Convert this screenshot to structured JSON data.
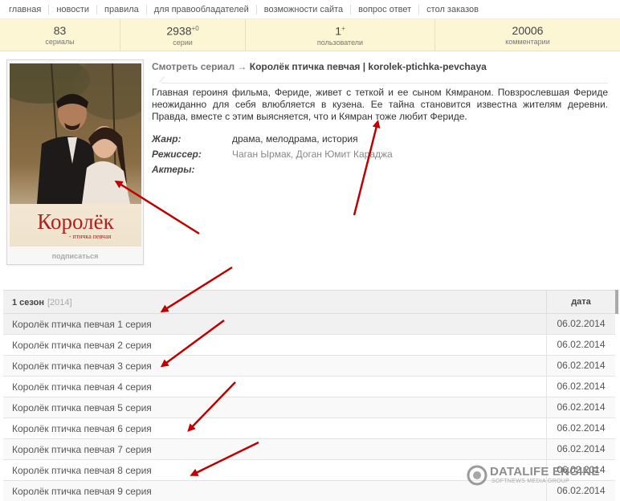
{
  "nav": {
    "items": [
      "главная",
      "новости",
      "правила",
      "для правообладателей",
      "возможности сайта",
      "вопрос ответ",
      "стол заказов"
    ]
  },
  "stats": [
    {
      "value": "83",
      "sup": "",
      "label": "сериалы"
    },
    {
      "value": "2938",
      "sup": "+0",
      "label": "серии"
    },
    {
      "value": "1",
      "sup": "+",
      "label": "пользователи"
    },
    {
      "value": "20006",
      "sup": "",
      "label": "комментарии"
    }
  ],
  "poster": {
    "title_big": "Королёк",
    "title_small": "- птичка певчая",
    "subscribe": "подписаться"
  },
  "series": {
    "title_prefix": "Смотреть сериал → ",
    "title": "Королёк птичка певчая | korolek-ptichka-pevchaya",
    "description": "Главная героиня фильма, Фериде, живет с теткой и ее сыном Кямраном. Повзрослевшая Фериде неожиданно для себя влюбляется в кузена. Ее тайна становится известна жителям деревни. Правда, вместе с этим выясняется, что и Кямран тоже любит Фериде.",
    "genre_label": "Жанр:",
    "genre": "драма, мелодрама, история",
    "director_label": "Режиссер:",
    "director": "Чаган Ырмак, Доган Юмит Караджа",
    "actors_label": "Актеры:"
  },
  "episodes": {
    "season": "1 сезон",
    "year": "[2014]",
    "date_header": "дата",
    "rows": [
      {
        "name": "Королёк птичка певчая 1 серия",
        "date": "06.02.2014"
      },
      {
        "name": "Королёк птичка певчая 2 серия",
        "date": "06.02.2014"
      },
      {
        "name": "Королёк птичка певчая 3 серия",
        "date": "06.02.2014"
      },
      {
        "name": "Королёк птичка певчая 4 серия",
        "date": "06.02.2014"
      },
      {
        "name": "Королёк птичка певчая 5 серия",
        "date": "06.02.2014"
      },
      {
        "name": "Королёк птичка певчая 6 серия",
        "date": "06.02.2014"
      },
      {
        "name": "Королёк птичка певчая 7 серия",
        "date": "06.02.2014"
      },
      {
        "name": "Королёк птичка певчая 8 серия",
        "date": "06.02.2014"
      },
      {
        "name": "Королёк птичка певчая 9 серия",
        "date": "06.02.2014"
      }
    ]
  },
  "watermark": {
    "name": "DATALIFE ENGINE",
    "sub": "SOFTNEWS MEDIA GROUP"
  },
  "colors": {
    "stats_bg": "#fcf6d4",
    "annotation_arrow": "#c00000",
    "poster_title": "#b0201e"
  }
}
